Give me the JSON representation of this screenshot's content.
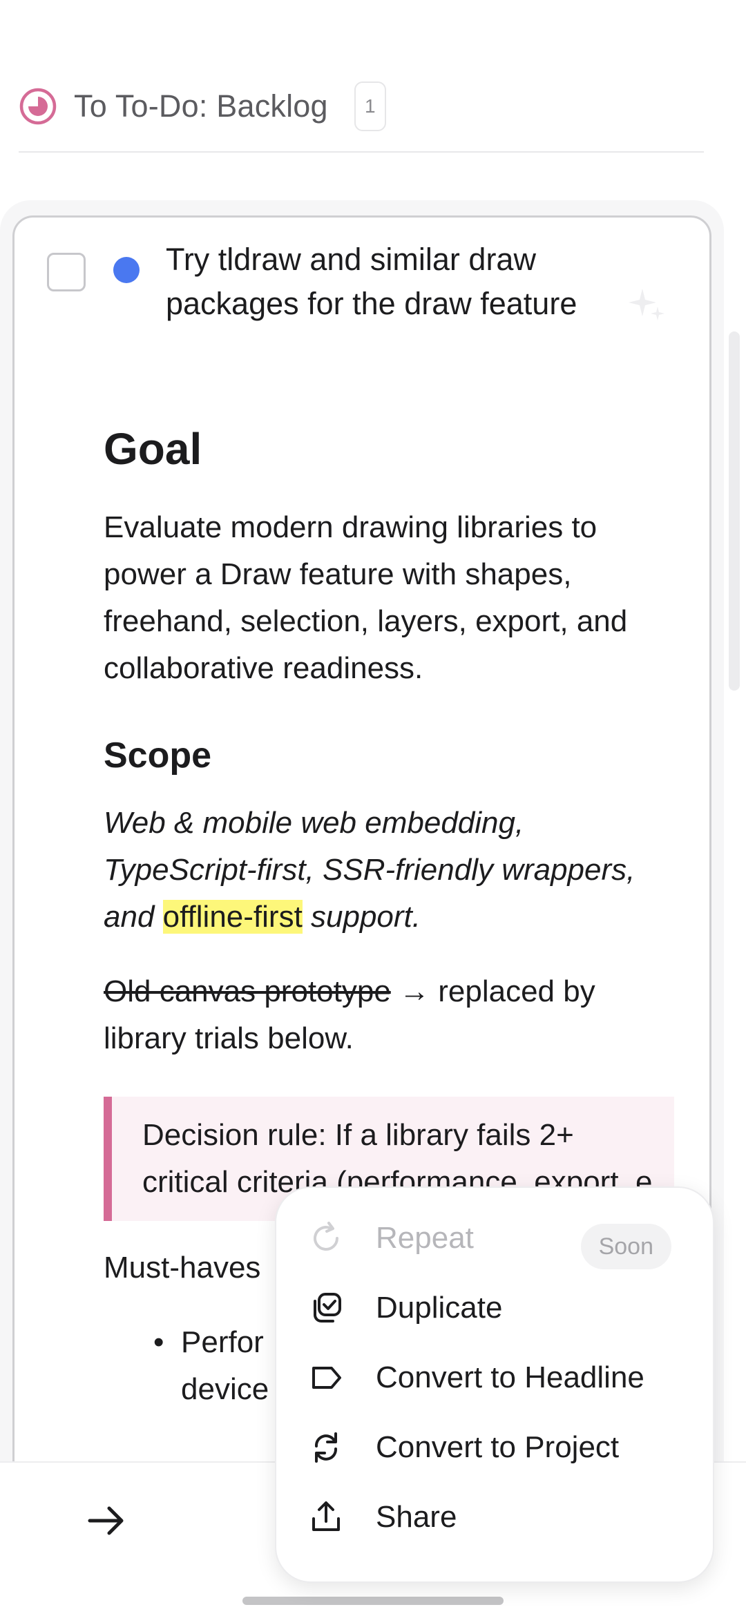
{
  "header": {
    "title": "To To-Do: Backlog",
    "count": "1",
    "area_icon_color": "#d56b96"
  },
  "todo": {
    "title": "Try tldraw and similar draw packages for the draw feature",
    "dot_color": "#4a78f0",
    "checked": false
  },
  "notes": {
    "goal_heading": "Goal",
    "goal_text": "Evaluate modern drawing libraries to power a Draw feature with shapes, freehand, selection, layers, export, and collaborative readiness.",
    "scope_heading": "Scope",
    "scope_part1": "Web & mobile web embedding, TypeScript-first, SSR-friendly wrappers, and ",
    "scope_highlight": "offline-first",
    "scope_part2": " support.",
    "strike_text": "Old canvas prototype",
    "strike_rest": " → replaced by library trials below.",
    "quote_text": "Decision rule: If a library fails 2+ critical criteria (performance, export, e",
    "musthaves": "Must-haves",
    "bullet1": "Perfor device"
  },
  "menu": {
    "items": [
      {
        "label": "Repeat",
        "icon": "repeat-icon",
        "disabled": true,
        "badge": "Soon"
      },
      {
        "label": "Duplicate",
        "icon": "duplicate-icon"
      },
      {
        "label": "Convert to Headline",
        "icon": "tag-icon"
      },
      {
        "label": "Convert to Project",
        "icon": "convert-project-icon"
      },
      {
        "label": "Share",
        "icon": "share-icon"
      }
    ]
  },
  "bottom": {
    "arrow_icon": "arrow-right-icon"
  }
}
